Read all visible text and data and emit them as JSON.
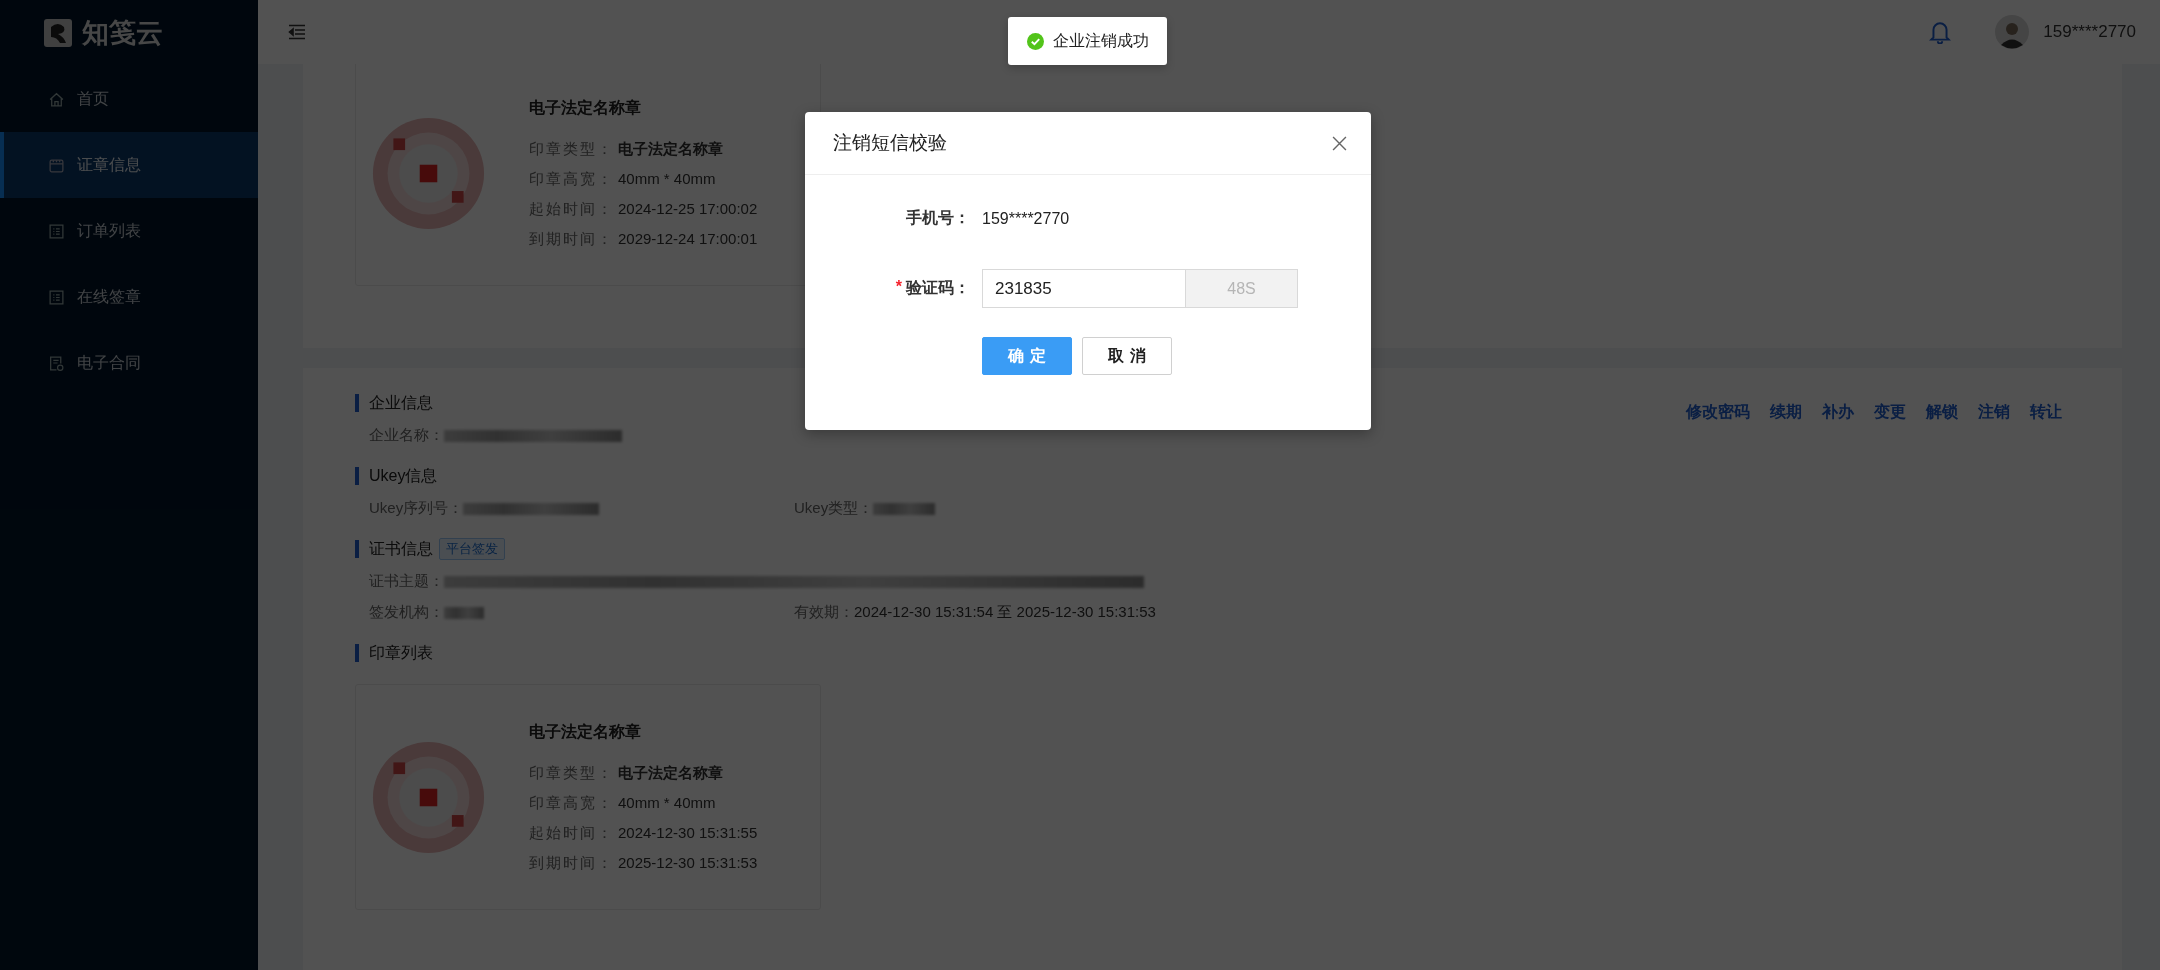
{
  "sidebar": {
    "logo": "知笺云",
    "items": [
      {
        "label": "首页",
        "kind": "home",
        "selected": false
      },
      {
        "label": "证章信息",
        "kind": "card",
        "selected": true
      },
      {
        "label": "订单列表",
        "kind": "list",
        "selected": false
      },
      {
        "label": "在线签章",
        "kind": "list",
        "selected": false
      },
      {
        "label": "电子合同",
        "kind": "contract",
        "selected": false
      }
    ]
  },
  "header": {
    "user": "159****2770"
  },
  "toast": {
    "message": "企业注销成功"
  },
  "top_seal": {
    "kind": "picture",
    "title": "电子法定名称章",
    "fields": [
      {
        "label": "印章类型：",
        "value": "电子法定名称章",
        "bold": true
      },
      {
        "label": "印章高宽：",
        "value": "40mm * 40mm",
        "bold": false
      },
      {
        "label": "起始时间：",
        "value": "2024-12-25 17:00:02",
        "bold": false
      },
      {
        "label": "到期时间：",
        "value": "2029-12-24 17:00:01",
        "bold": false
      }
    ]
  },
  "sections": [
    {
      "title": "企业信息",
      "rows": [
        [
          {
            "label": "企业名称：",
            "redacted": true
          }
        ]
      ]
    },
    {
      "title": "Ukey信息",
      "rows": [
        [
          {
            "label": "Ukey序列号：",
            "redacted": true
          },
          {
            "label": "Ukey类型：",
            "redacted": true
          }
        ]
      ]
    },
    {
      "title": "证书信息",
      "badge": "平台签发",
      "rows": [
        [
          {
            "label": "证书主题：",
            "redacted": true
          }
        ],
        [
          {
            "label": "签发机构：",
            "redacted": true
          },
          {
            "label": "有效期：",
            "value": "2024-12-30 15:31:54 至 2025-12-30 15:31:53"
          }
        ]
      ]
    },
    {
      "title": "印章列表"
    }
  ],
  "actions": [
    "修改密码",
    "续期",
    "补办",
    "变更",
    "解锁",
    "注销",
    "转让"
  ],
  "seal_list": [
    {
      "kind": "picture",
      "title": "电子法定名称章",
      "fields": [
        {
          "label": "印章类型：",
          "value": "电子法定名称章",
          "bold": true
        },
        {
          "label": "印章高宽：",
          "value": "40mm * 40mm",
          "bold": false
        },
        {
          "label": "起始时间：",
          "value": "2024-12-30 15:31:55",
          "bold": false
        },
        {
          "label": "到期时间：",
          "value": "2025-12-30 15:31:53",
          "bold": false
        }
      ]
    }
  ],
  "dialog": {
    "title": "注销短信校验",
    "phone_label": "手机号：",
    "phone": "159****2770",
    "code_label": "验证码：",
    "required_mark": "*",
    "code": "231835",
    "countdown": "48S",
    "countdown_disabled": true,
    "confirm": "确定",
    "cancel": "取消"
  }
}
